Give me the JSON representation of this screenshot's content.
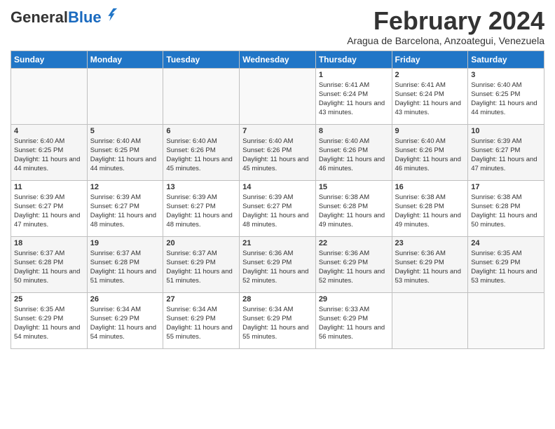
{
  "header": {
    "logo_general": "General",
    "logo_blue": "Blue",
    "month_title": "February 2024",
    "subtitle": "Aragua de Barcelona, Anzoategui, Venezuela"
  },
  "days_of_week": [
    "Sunday",
    "Monday",
    "Tuesday",
    "Wednesday",
    "Thursday",
    "Friday",
    "Saturday"
  ],
  "weeks": [
    [
      {
        "date": "",
        "info": ""
      },
      {
        "date": "",
        "info": ""
      },
      {
        "date": "",
        "info": ""
      },
      {
        "date": "",
        "info": ""
      },
      {
        "date": "1",
        "info": "Sunrise: 6:41 AM\nSunset: 6:24 PM\nDaylight: 11 hours and 43 minutes."
      },
      {
        "date": "2",
        "info": "Sunrise: 6:41 AM\nSunset: 6:24 PM\nDaylight: 11 hours and 43 minutes."
      },
      {
        "date": "3",
        "info": "Sunrise: 6:40 AM\nSunset: 6:25 PM\nDaylight: 11 hours and 44 minutes."
      }
    ],
    [
      {
        "date": "4",
        "info": "Sunrise: 6:40 AM\nSunset: 6:25 PM\nDaylight: 11 hours and 44 minutes."
      },
      {
        "date": "5",
        "info": "Sunrise: 6:40 AM\nSunset: 6:25 PM\nDaylight: 11 hours and 44 minutes."
      },
      {
        "date": "6",
        "info": "Sunrise: 6:40 AM\nSunset: 6:26 PM\nDaylight: 11 hours and 45 minutes."
      },
      {
        "date": "7",
        "info": "Sunrise: 6:40 AM\nSunset: 6:26 PM\nDaylight: 11 hours and 45 minutes."
      },
      {
        "date": "8",
        "info": "Sunrise: 6:40 AM\nSunset: 6:26 PM\nDaylight: 11 hours and 46 minutes."
      },
      {
        "date": "9",
        "info": "Sunrise: 6:40 AM\nSunset: 6:26 PM\nDaylight: 11 hours and 46 minutes."
      },
      {
        "date": "10",
        "info": "Sunrise: 6:39 AM\nSunset: 6:27 PM\nDaylight: 11 hours and 47 minutes."
      }
    ],
    [
      {
        "date": "11",
        "info": "Sunrise: 6:39 AM\nSunset: 6:27 PM\nDaylight: 11 hours and 47 minutes."
      },
      {
        "date": "12",
        "info": "Sunrise: 6:39 AM\nSunset: 6:27 PM\nDaylight: 11 hours and 48 minutes."
      },
      {
        "date": "13",
        "info": "Sunrise: 6:39 AM\nSunset: 6:27 PM\nDaylight: 11 hours and 48 minutes."
      },
      {
        "date": "14",
        "info": "Sunrise: 6:39 AM\nSunset: 6:27 PM\nDaylight: 11 hours and 48 minutes."
      },
      {
        "date": "15",
        "info": "Sunrise: 6:38 AM\nSunset: 6:28 PM\nDaylight: 11 hours and 49 minutes."
      },
      {
        "date": "16",
        "info": "Sunrise: 6:38 AM\nSunset: 6:28 PM\nDaylight: 11 hours and 49 minutes."
      },
      {
        "date": "17",
        "info": "Sunrise: 6:38 AM\nSunset: 6:28 PM\nDaylight: 11 hours and 50 minutes."
      }
    ],
    [
      {
        "date": "18",
        "info": "Sunrise: 6:37 AM\nSunset: 6:28 PM\nDaylight: 11 hours and 50 minutes."
      },
      {
        "date": "19",
        "info": "Sunrise: 6:37 AM\nSunset: 6:28 PM\nDaylight: 11 hours and 51 minutes."
      },
      {
        "date": "20",
        "info": "Sunrise: 6:37 AM\nSunset: 6:29 PM\nDaylight: 11 hours and 51 minutes."
      },
      {
        "date": "21",
        "info": "Sunrise: 6:36 AM\nSunset: 6:29 PM\nDaylight: 11 hours and 52 minutes."
      },
      {
        "date": "22",
        "info": "Sunrise: 6:36 AM\nSunset: 6:29 PM\nDaylight: 11 hours and 52 minutes."
      },
      {
        "date": "23",
        "info": "Sunrise: 6:36 AM\nSunset: 6:29 PM\nDaylight: 11 hours and 53 minutes."
      },
      {
        "date": "24",
        "info": "Sunrise: 6:35 AM\nSunset: 6:29 PM\nDaylight: 11 hours and 53 minutes."
      }
    ],
    [
      {
        "date": "25",
        "info": "Sunrise: 6:35 AM\nSunset: 6:29 PM\nDaylight: 11 hours and 54 minutes."
      },
      {
        "date": "26",
        "info": "Sunrise: 6:34 AM\nSunset: 6:29 PM\nDaylight: 11 hours and 54 minutes."
      },
      {
        "date": "27",
        "info": "Sunrise: 6:34 AM\nSunset: 6:29 PM\nDaylight: 11 hours and 55 minutes."
      },
      {
        "date": "28",
        "info": "Sunrise: 6:34 AM\nSunset: 6:29 PM\nDaylight: 11 hours and 55 minutes."
      },
      {
        "date": "29",
        "info": "Sunrise: 6:33 AM\nSunset: 6:29 PM\nDaylight: 11 hours and 56 minutes."
      },
      {
        "date": "",
        "info": ""
      },
      {
        "date": "",
        "info": ""
      }
    ]
  ]
}
